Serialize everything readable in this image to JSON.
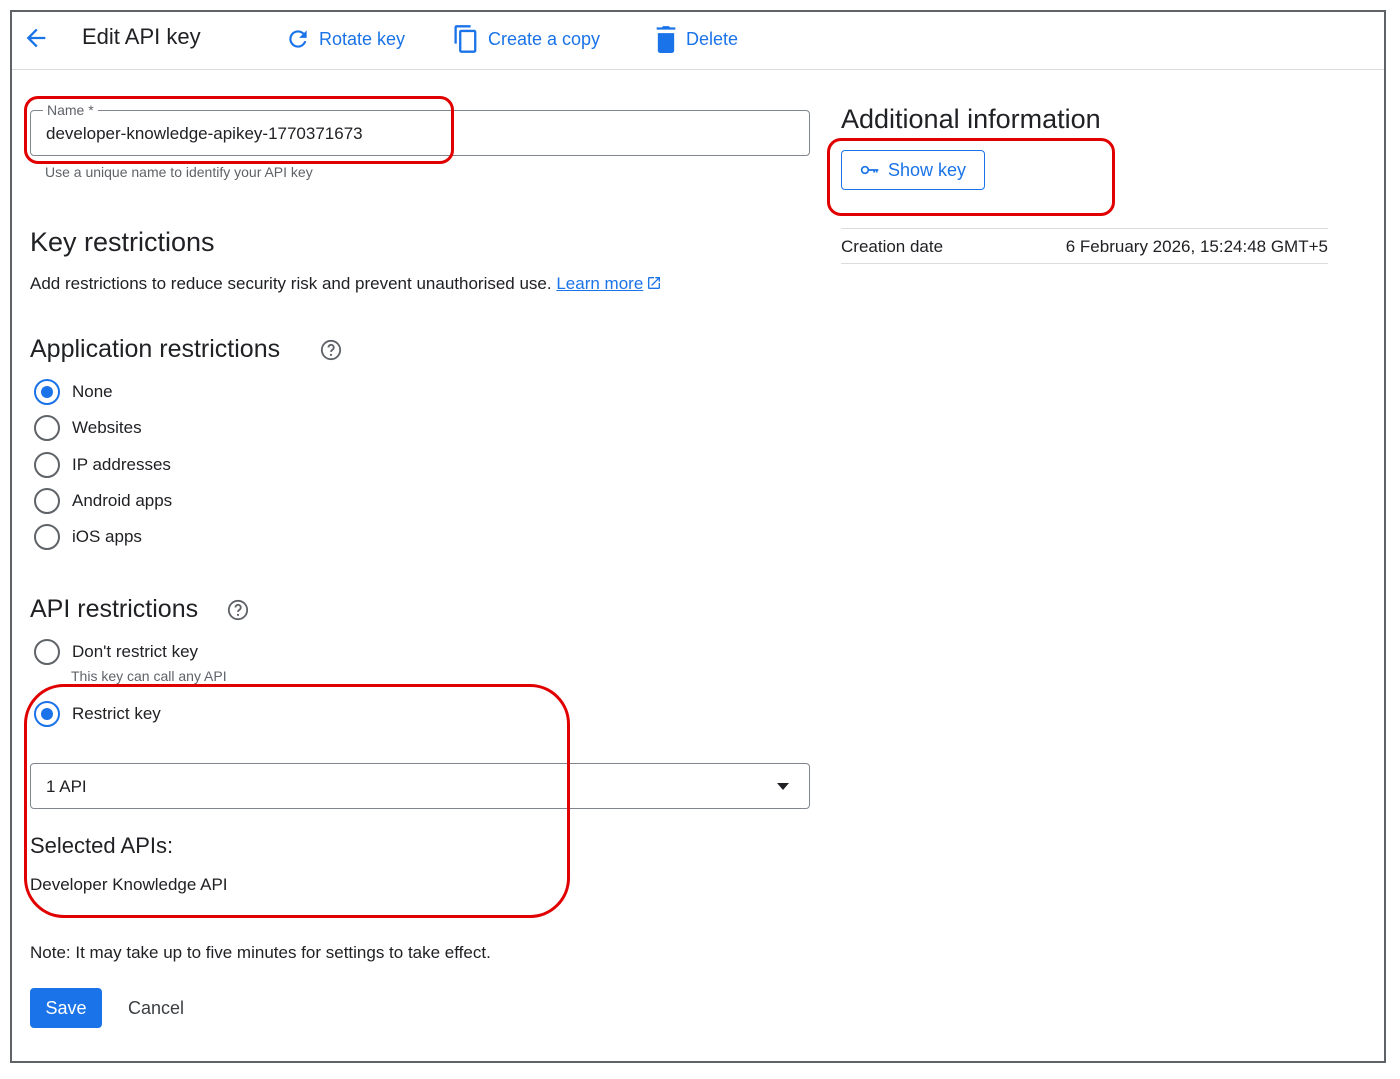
{
  "header": {
    "title": "Edit API key",
    "rotate_label": "Rotate key",
    "copy_label": "Create a copy",
    "delete_label": "Delete"
  },
  "name_field": {
    "label": "Name *",
    "value": "developer-knowledge-apikey-1770371673",
    "helper": "Use a unique name to identify your API key"
  },
  "key_restrictions": {
    "title": "Key restrictions",
    "description": "Add restrictions to reduce security risk and prevent unauthorised use.",
    "learn_more": "Learn more"
  },
  "app_restrictions": {
    "title": "Application restrictions",
    "options": [
      "None",
      "Websites",
      "IP addresses",
      "Android apps",
      "iOS apps"
    ],
    "selected": "None"
  },
  "api_restrictions": {
    "title": "API restrictions",
    "dont_restrict": "Don't restrict key",
    "dont_restrict_sub": "This key can call any API",
    "restrict": "Restrict key",
    "selected": "Restrict key",
    "select_value": "1 API",
    "selected_title": "Selected APIs:",
    "selected_apis": [
      "Developer Knowledge API"
    ]
  },
  "note": "Note: It may take up to five minutes for settings to take effect.",
  "actions": {
    "save": "Save",
    "cancel": "Cancel"
  },
  "additional_info": {
    "title": "Additional information",
    "show_key": "Show key",
    "creation_label": "Creation date",
    "creation_value": "6 February 2026, 15:24:48 GMT+5"
  },
  "colors": {
    "accent": "#1a73e8",
    "annotation": "#e00000"
  }
}
